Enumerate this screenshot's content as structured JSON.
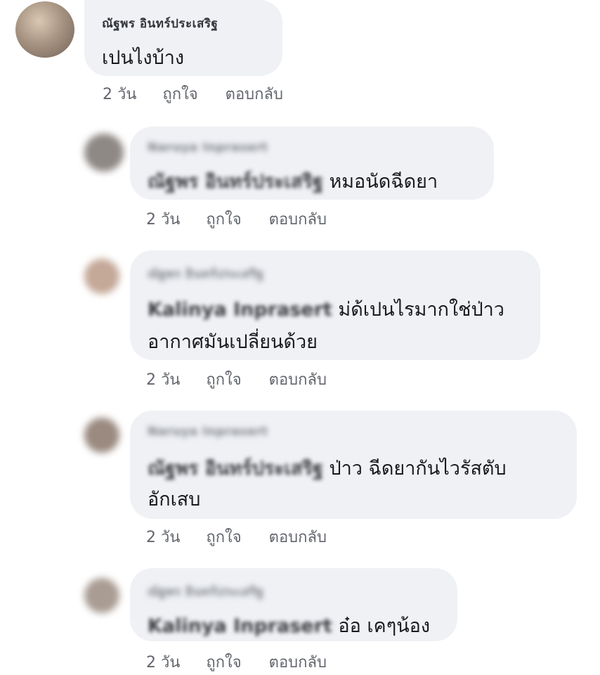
{
  "comments": [
    {
      "author": "ณัฐพร อินทร์ประเสริฐ",
      "lines": [
        {
          "mention": "",
          "text": "เปนไงบ้าง"
        }
      ],
      "time": "2 วัน",
      "like": "ถูกใจ",
      "reply": "ตอบกลับ"
    },
    {
      "author": "Naruya Inprasert",
      "lines": [
        {
          "mention": "ณัฐพร อินทร์ประเสริฐ",
          "text": " หมอนัดฉีดยา"
        }
      ],
      "time": "2 วัน",
      "like": "ถูกใจ",
      "reply": "ตอบกลับ"
    },
    {
      "author": "ณัฐพร อินทร์ประเสริฐ",
      "lines": [
        {
          "mention": "Kalinya Inprasert",
          "text": " ม่ด้เปนไรมากใช่ป่าว"
        },
        {
          "mention": "",
          "text": "อากาศมันเปลี่ยนด้วย"
        }
      ],
      "time": "2 วัน",
      "like": "ถูกใจ",
      "reply": "ตอบกลับ"
    },
    {
      "author": "Naruya Inprasert",
      "lines": [
        {
          "mention": "ณัฐพร อินทร์ประเสริฐ",
          "text": "  ป่าว ฉีดยากันไวรัสตับ"
        },
        {
          "mention": "",
          "text": "อักเสบ"
        }
      ],
      "time": "2 วัน",
      "like": "ถูกใจ",
      "reply": "ตอบกลับ"
    },
    {
      "author": "ณัฐพร อินทร์ประเสริฐ",
      "lines": [
        {
          "mention": "Kalinya Inprasert",
          "text": " อ๋อ เคๆน้อง"
        }
      ],
      "time": "2 วัน",
      "like": "ถูกใจ",
      "reply": "ตอบกลับ"
    }
  ]
}
